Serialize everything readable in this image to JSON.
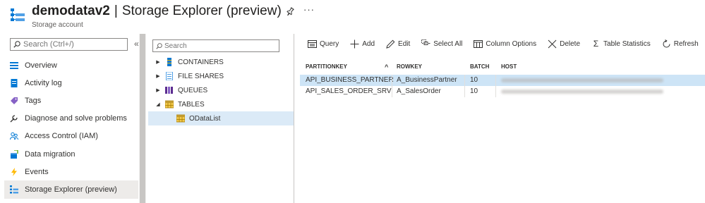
{
  "header": {
    "title": "demodatav2",
    "separator": "|",
    "subtitle_title": "Storage Explorer (preview)",
    "account_type": "Storage account",
    "more": "···"
  },
  "nav": {
    "search_placeholder": "Search (Ctrl+/)",
    "collapse": "«",
    "items": [
      {
        "label": "Overview",
        "icon": "overview-icon"
      },
      {
        "label": "Activity log",
        "icon": "activity-log-icon"
      },
      {
        "label": "Tags",
        "icon": "tag-icon"
      },
      {
        "label": "Diagnose and solve problems",
        "icon": "wrench-icon"
      },
      {
        "label": "Access Control (IAM)",
        "icon": "people-icon"
      },
      {
        "label": "Data migration",
        "icon": "data-migration-icon"
      },
      {
        "label": "Events",
        "icon": "lightning-icon"
      },
      {
        "label": "Storage Explorer (preview)",
        "icon": "storage-explorer-icon",
        "active": true
      }
    ]
  },
  "tree": {
    "search_placeholder": "Search",
    "items": [
      {
        "label": "CONTAINERS",
        "expanded": false
      },
      {
        "label": "FILE SHARES",
        "expanded": false
      },
      {
        "label": "QUEUES",
        "expanded": false
      },
      {
        "label": "TABLES",
        "expanded": true
      },
      {
        "label": "ODataList",
        "child": true,
        "selected": true
      }
    ]
  },
  "toolbar": {
    "query": "Query",
    "add": "Add",
    "edit": "Edit",
    "select_all": "Select All",
    "column_options": "Column Options",
    "delete": "Delete",
    "table_statistics": "Table Statistics",
    "refresh": "Refresh"
  },
  "table": {
    "columns": [
      "PARTITIONKEY",
      "ROWKEY",
      "BATCH",
      "HOST"
    ],
    "sort_indicator": "^",
    "rows": [
      {
        "partitionkey": "API_BUSINESS_PARTNER",
        "rowkey": "A_BusinessPartner",
        "batch": "10",
        "selected": true
      },
      {
        "partitionkey": "API_SALES_ORDER_SRV",
        "rowkey": "A_SalesOrder",
        "batch": "10",
        "selected": false
      }
    ]
  },
  "colors": {
    "accent": "#0078d4",
    "selected_row": "#cde4f6",
    "nav_active": "#edebe9"
  }
}
